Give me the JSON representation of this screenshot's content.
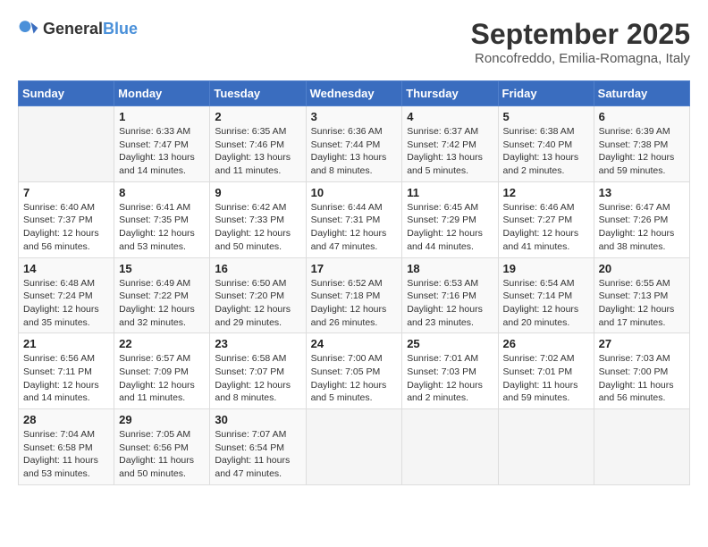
{
  "header": {
    "logo": {
      "general": "General",
      "blue": "Blue"
    },
    "month": "September 2025",
    "location": "Roncofreddo, Emilia-Romagna, Italy"
  },
  "weekdays": [
    "Sunday",
    "Monday",
    "Tuesday",
    "Wednesday",
    "Thursday",
    "Friday",
    "Saturday"
  ],
  "weeks": [
    [
      {
        "day": "",
        "info": ""
      },
      {
        "day": "1",
        "info": "Sunrise: 6:33 AM\nSunset: 7:47 PM\nDaylight: 13 hours\nand 14 minutes."
      },
      {
        "day": "2",
        "info": "Sunrise: 6:35 AM\nSunset: 7:46 PM\nDaylight: 13 hours\nand 11 minutes."
      },
      {
        "day": "3",
        "info": "Sunrise: 6:36 AM\nSunset: 7:44 PM\nDaylight: 13 hours\nand 8 minutes."
      },
      {
        "day": "4",
        "info": "Sunrise: 6:37 AM\nSunset: 7:42 PM\nDaylight: 13 hours\nand 5 minutes."
      },
      {
        "day": "5",
        "info": "Sunrise: 6:38 AM\nSunset: 7:40 PM\nDaylight: 13 hours\nand 2 minutes."
      },
      {
        "day": "6",
        "info": "Sunrise: 6:39 AM\nSunset: 7:38 PM\nDaylight: 12 hours\nand 59 minutes."
      }
    ],
    [
      {
        "day": "7",
        "info": "Sunrise: 6:40 AM\nSunset: 7:37 PM\nDaylight: 12 hours\nand 56 minutes."
      },
      {
        "day": "8",
        "info": "Sunrise: 6:41 AM\nSunset: 7:35 PM\nDaylight: 12 hours\nand 53 minutes."
      },
      {
        "day": "9",
        "info": "Sunrise: 6:42 AM\nSunset: 7:33 PM\nDaylight: 12 hours\nand 50 minutes."
      },
      {
        "day": "10",
        "info": "Sunrise: 6:44 AM\nSunset: 7:31 PM\nDaylight: 12 hours\nand 47 minutes."
      },
      {
        "day": "11",
        "info": "Sunrise: 6:45 AM\nSunset: 7:29 PM\nDaylight: 12 hours\nand 44 minutes."
      },
      {
        "day": "12",
        "info": "Sunrise: 6:46 AM\nSunset: 7:27 PM\nDaylight: 12 hours\nand 41 minutes."
      },
      {
        "day": "13",
        "info": "Sunrise: 6:47 AM\nSunset: 7:26 PM\nDaylight: 12 hours\nand 38 minutes."
      }
    ],
    [
      {
        "day": "14",
        "info": "Sunrise: 6:48 AM\nSunset: 7:24 PM\nDaylight: 12 hours\nand 35 minutes."
      },
      {
        "day": "15",
        "info": "Sunrise: 6:49 AM\nSunset: 7:22 PM\nDaylight: 12 hours\nand 32 minutes."
      },
      {
        "day": "16",
        "info": "Sunrise: 6:50 AM\nSunset: 7:20 PM\nDaylight: 12 hours\nand 29 minutes."
      },
      {
        "day": "17",
        "info": "Sunrise: 6:52 AM\nSunset: 7:18 PM\nDaylight: 12 hours\nand 26 minutes."
      },
      {
        "day": "18",
        "info": "Sunrise: 6:53 AM\nSunset: 7:16 PM\nDaylight: 12 hours\nand 23 minutes."
      },
      {
        "day": "19",
        "info": "Sunrise: 6:54 AM\nSunset: 7:14 PM\nDaylight: 12 hours\nand 20 minutes."
      },
      {
        "day": "20",
        "info": "Sunrise: 6:55 AM\nSunset: 7:13 PM\nDaylight: 12 hours\nand 17 minutes."
      }
    ],
    [
      {
        "day": "21",
        "info": "Sunrise: 6:56 AM\nSunset: 7:11 PM\nDaylight: 12 hours\nand 14 minutes."
      },
      {
        "day": "22",
        "info": "Sunrise: 6:57 AM\nSunset: 7:09 PM\nDaylight: 12 hours\nand 11 minutes."
      },
      {
        "day": "23",
        "info": "Sunrise: 6:58 AM\nSunset: 7:07 PM\nDaylight: 12 hours\nand 8 minutes."
      },
      {
        "day": "24",
        "info": "Sunrise: 7:00 AM\nSunset: 7:05 PM\nDaylight: 12 hours\nand 5 minutes."
      },
      {
        "day": "25",
        "info": "Sunrise: 7:01 AM\nSunset: 7:03 PM\nDaylight: 12 hours\nand 2 minutes."
      },
      {
        "day": "26",
        "info": "Sunrise: 7:02 AM\nSunset: 7:01 PM\nDaylight: 11 hours\nand 59 minutes."
      },
      {
        "day": "27",
        "info": "Sunrise: 7:03 AM\nSunset: 7:00 PM\nDaylight: 11 hours\nand 56 minutes."
      }
    ],
    [
      {
        "day": "28",
        "info": "Sunrise: 7:04 AM\nSunset: 6:58 PM\nDaylight: 11 hours\nand 53 minutes."
      },
      {
        "day": "29",
        "info": "Sunrise: 7:05 AM\nSunset: 6:56 PM\nDaylight: 11 hours\nand 50 minutes."
      },
      {
        "day": "30",
        "info": "Sunrise: 7:07 AM\nSunset: 6:54 PM\nDaylight: 11 hours\nand 47 minutes."
      },
      {
        "day": "",
        "info": ""
      },
      {
        "day": "",
        "info": ""
      },
      {
        "day": "",
        "info": ""
      },
      {
        "day": "",
        "info": ""
      }
    ]
  ]
}
